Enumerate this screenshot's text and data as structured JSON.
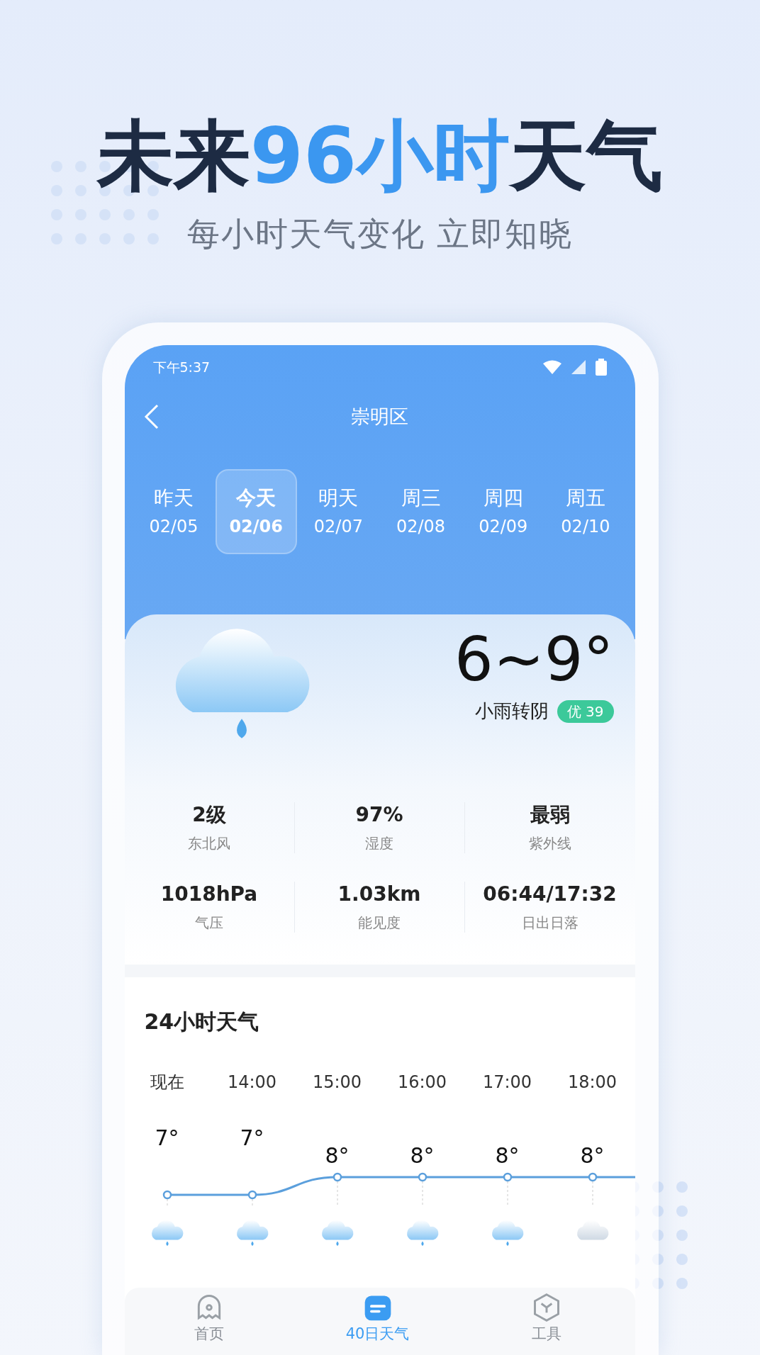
{
  "headline": {
    "part_1": "未来",
    "part_2": "96小时",
    "part_3": "天气"
  },
  "subtitle": "每小时天气变化 立即知晓",
  "status_bar": {
    "time": "下午5:37"
  },
  "header": {
    "title": "崇明区"
  },
  "days": [
    {
      "label": "昨天",
      "date": "02/05",
      "selected": false
    },
    {
      "label": "今天",
      "date": "02/06",
      "selected": true
    },
    {
      "label": "明天",
      "date": "02/07",
      "selected": false
    },
    {
      "label": "周三",
      "date": "02/08",
      "selected": false
    },
    {
      "label": "周四",
      "date": "02/09",
      "selected": false
    },
    {
      "label": "周五",
      "date": "02/10",
      "selected": false
    }
  ],
  "today": {
    "temperature": "6~9°",
    "condition": "小雨转阴",
    "aqi": "优 39"
  },
  "stats": [
    {
      "value": "2级",
      "label": "东北风"
    },
    {
      "value": "97%",
      "label": "湿度"
    },
    {
      "value": "最弱",
      "label": "紫外线"
    },
    {
      "value": "1018hPa",
      "label": "气压"
    },
    {
      "value": "1.03km",
      "label": "能见度"
    },
    {
      "value": "06:44/17:32",
      "label": "日出日落"
    }
  ],
  "hourly": {
    "title": "24小时天气",
    "hours": [
      {
        "time": "现在",
        "temp": "7°",
        "kind": "rain"
      },
      {
        "time": "14:00",
        "temp": "7°",
        "kind": "rain"
      },
      {
        "time": "15:00",
        "temp": "8°",
        "kind": "rain"
      },
      {
        "time": "16:00",
        "temp": "8°",
        "kind": "rain"
      },
      {
        "time": "17:00",
        "temp": "8°",
        "kind": "rain"
      },
      {
        "time": "18:00",
        "temp": "8°",
        "kind": "cloudy"
      }
    ]
  },
  "nav": [
    {
      "label": "首页",
      "kind": "home",
      "selected": false
    },
    {
      "label": "40日天气",
      "kind": "forecast",
      "selected": true
    },
    {
      "label": "工具",
      "kind": "tools",
      "selected": false
    }
  ]
}
